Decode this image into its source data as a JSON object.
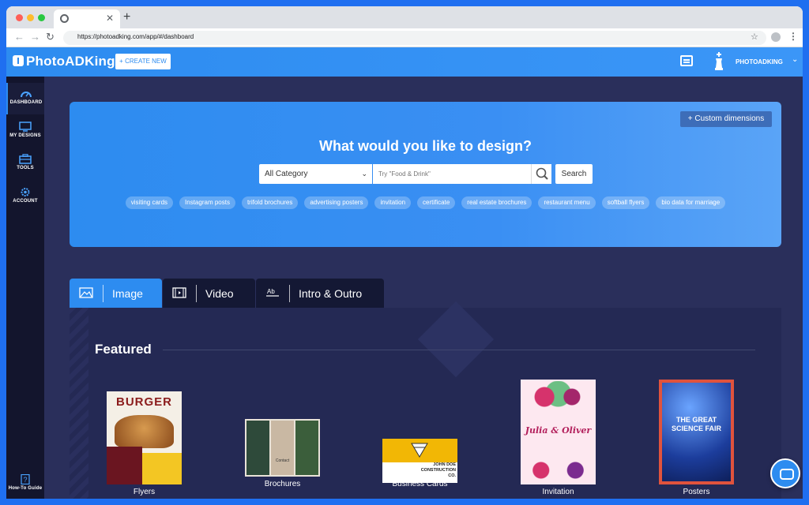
{
  "browser": {
    "url": "https://photoadking.com/app/#/dashboard",
    "new_tab_label": "+"
  },
  "header": {
    "logo": "PhotoADKing",
    "create_new": "+ CREATE NEW",
    "user_name": "PHOTOADKING"
  },
  "sidebar": {
    "items": [
      {
        "label": "DASHBOARD"
      },
      {
        "label": "MY DESIGNS"
      },
      {
        "label": "TOOLS"
      },
      {
        "label": "ACCOUNT"
      }
    ],
    "howto": "How-To Guide"
  },
  "hero": {
    "custom_dimensions": "+ Custom dimensions",
    "title": "What would you like to design?",
    "category": "All Category",
    "search_placeholder": "Try \"Food & Drink\"",
    "search_button": "Search",
    "tags": [
      "visiting cards",
      "Instagram posts",
      "trifold brochures",
      "advertising posters",
      "invitation",
      "certificate",
      "real estate brochures",
      "restaurant menu",
      "softball flyers",
      "bio data for marriage"
    ]
  },
  "tabs": [
    {
      "label": "Image"
    },
    {
      "label": "Video"
    },
    {
      "label": "Intro & Outro"
    }
  ],
  "featured": {
    "title": "Featured",
    "cards": [
      {
        "label": "Flyers",
        "thumb_text": "BURGER"
      },
      {
        "label": "Brochures",
        "thumb_text": "Contact"
      },
      {
        "label": "Business Cards",
        "thumb_text": "JOHN DOE CONSTRUCTION CO."
      },
      {
        "label": "Invitation",
        "thumb_text": "Julia & Oliver"
      },
      {
        "label": "Posters",
        "thumb_text": "THE GREAT SCIENCE FAIR"
      }
    ]
  }
}
